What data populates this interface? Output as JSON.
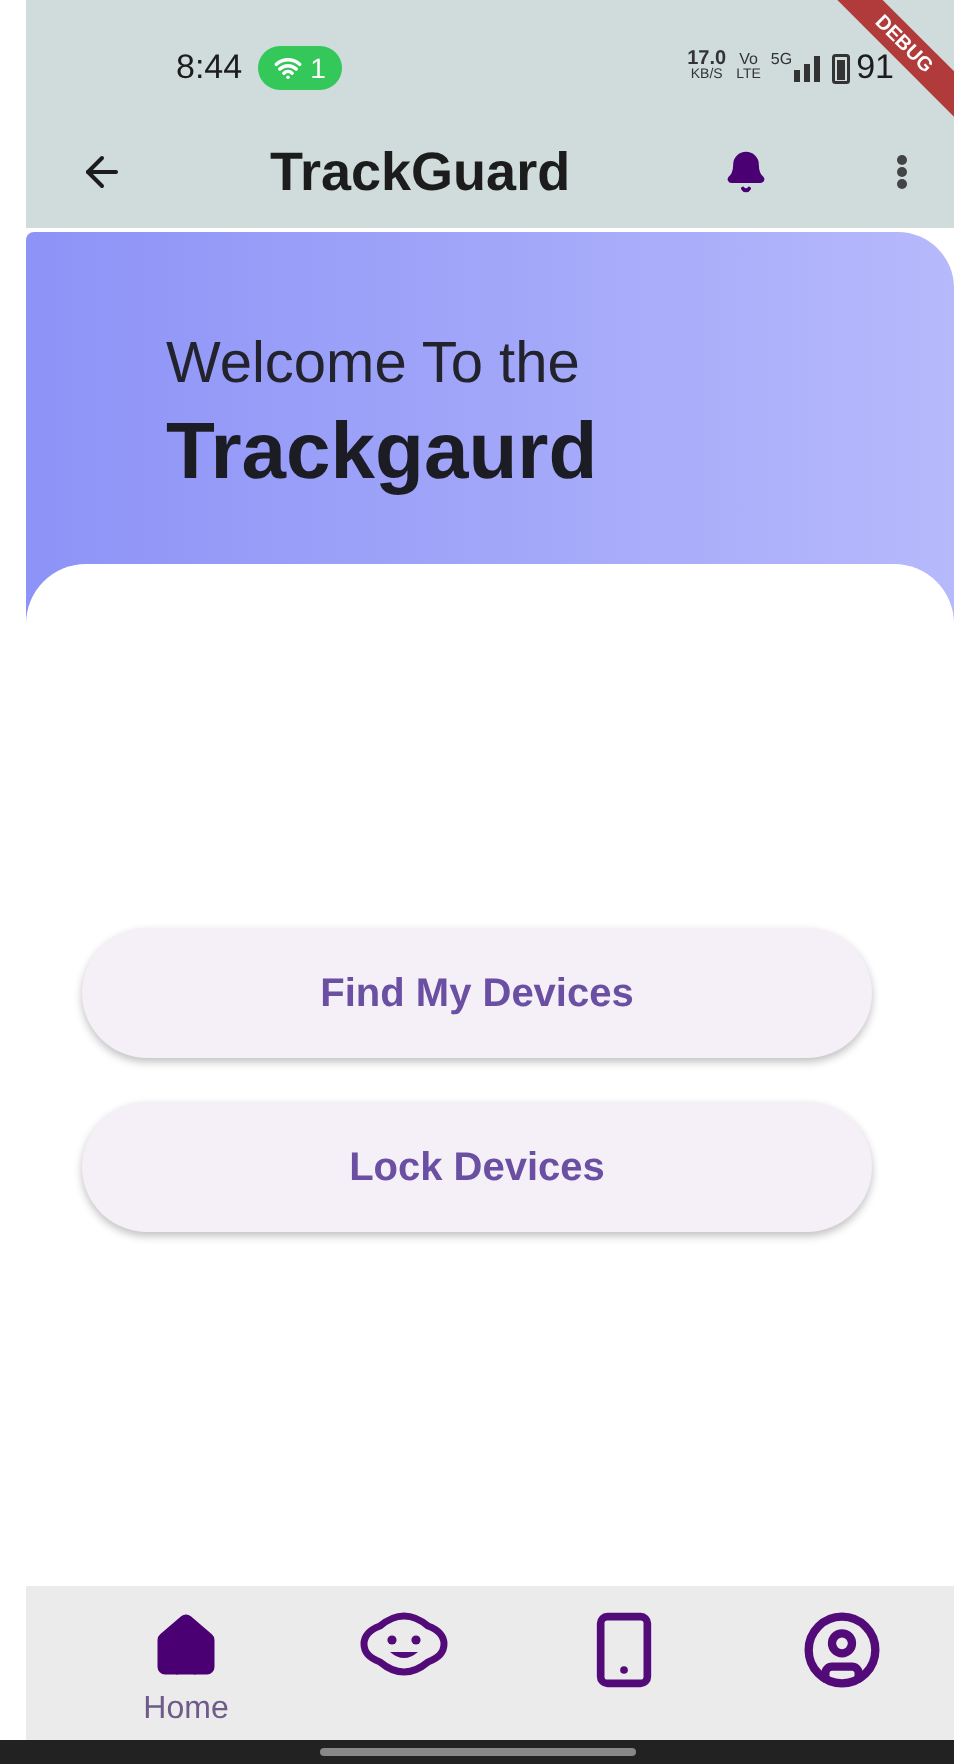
{
  "status_bar": {
    "time": "8:44",
    "hotspot_count": "1",
    "speed": "17.0",
    "speed_unit": "KB/S",
    "volte_top": "Vo",
    "volte_bottom": "LTE",
    "network": "5G",
    "battery": "91"
  },
  "debug_banner": "DEBUG",
  "app_bar": {
    "title": "TrackGuard"
  },
  "header": {
    "greeting": "Welcome To the",
    "name": "Trackgaurd"
  },
  "buttons": [
    "Find My Devices",
    "Lock Devices"
  ],
  "bottom_nav": [
    {
      "kind": "home",
      "label": "Home",
      "selected": true
    },
    {
      "kind": "face",
      "selected": false
    },
    {
      "kind": "phone",
      "selected": false
    },
    {
      "kind": "account",
      "selected": false
    }
  ]
}
